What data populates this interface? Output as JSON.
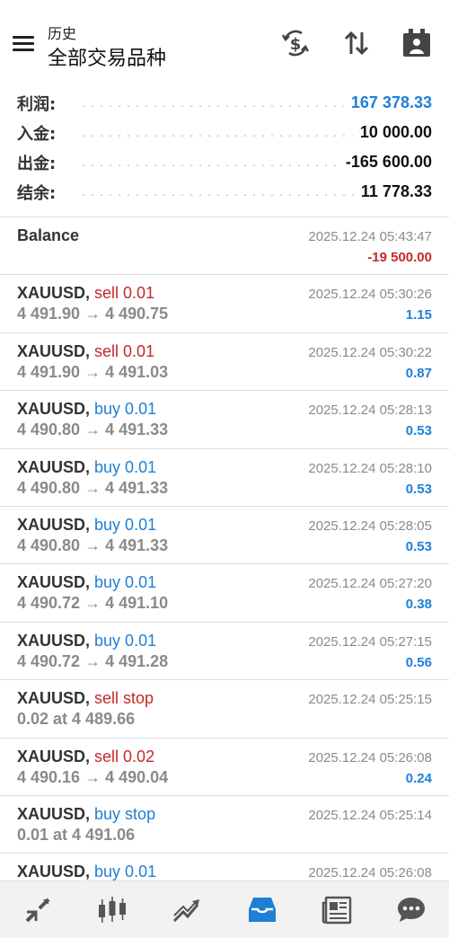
{
  "header": {
    "subtitle": "历史",
    "title": "全部交易品种",
    "icons": [
      "menu-icon",
      "currency-exchange-icon",
      "sort-icon",
      "calendar-period-icon"
    ]
  },
  "summary": [
    {
      "label": "利润:",
      "value": "167 378.33",
      "color": "#1e7fd6"
    },
    {
      "label": "入金:",
      "value": "10 000.00"
    },
    {
      "label": "出金:",
      "value": "-165 600.00"
    },
    {
      "label": "结余:",
      "value": "11 778.33"
    }
  ],
  "deals": [
    {
      "symbol": "Balance",
      "sep": "",
      "action": "",
      "side": "",
      "detail": "",
      "time": "2025.12.24 05:43:47",
      "profit": "-19 500.00",
      "sign": "neg"
    },
    {
      "symbol": "XAUUSD",
      "sep": ", ",
      "action": "sell 0.01",
      "side": "sell",
      "detail": "4 491.90 → 4 490.75",
      "time": "2025.12.24 05:30:26",
      "profit": "1.15",
      "sign": "pos"
    },
    {
      "symbol": "XAUUSD",
      "sep": ", ",
      "action": "sell 0.01",
      "side": "sell",
      "detail": "4 491.90 → 4 491.03",
      "time": "2025.12.24 05:30:22",
      "profit": "0.87",
      "sign": "pos"
    },
    {
      "symbol": "XAUUSD",
      "sep": ", ",
      "action": "buy 0.01",
      "side": "buy",
      "detail": "4 490.80 → 4 491.33",
      "time": "2025.12.24 05:28:13",
      "profit": "0.53",
      "sign": "pos"
    },
    {
      "symbol": "XAUUSD",
      "sep": ", ",
      "action": "buy 0.01",
      "side": "buy",
      "detail": "4 490.80 → 4 491.33",
      "time": "2025.12.24 05:28:10",
      "profit": "0.53",
      "sign": "pos"
    },
    {
      "symbol": "XAUUSD",
      "sep": ", ",
      "action": "buy 0.01",
      "side": "buy",
      "detail": "4 490.80 → 4 491.33",
      "time": "2025.12.24 05:28:05",
      "profit": "0.53",
      "sign": "pos"
    },
    {
      "symbol": "XAUUSD",
      "sep": ", ",
      "action": "buy 0.01",
      "side": "buy",
      "detail": "4 490.72 → 4 491.10",
      "time": "2025.12.24 05:27:20",
      "profit": "0.38",
      "sign": "pos"
    },
    {
      "symbol": "XAUUSD",
      "sep": ", ",
      "action": "buy 0.01",
      "side": "buy",
      "detail": "4 490.72 → 4 491.28",
      "time": "2025.12.24 05:27:15",
      "profit": "0.56",
      "sign": "pos"
    },
    {
      "symbol": "XAUUSD",
      "sep": ", ",
      "action": "sell stop",
      "side": "sell",
      "detail": "0.02 at 4 489.66",
      "time": "2025.12.24 05:25:15",
      "profit": "",
      "sign": "pos"
    },
    {
      "symbol": "XAUUSD",
      "sep": ", ",
      "action": "sell 0.02",
      "side": "sell",
      "detail": "4 490.16 → 4 490.04",
      "time": "2025.12.24 05:26:08",
      "profit": "0.24",
      "sign": "pos"
    },
    {
      "symbol": "XAUUSD",
      "sep": ", ",
      "action": "buy stop",
      "side": "buy",
      "detail": "0.01 at 4 491.06",
      "time": "2025.12.24 05:25:14",
      "profit": "",
      "sign": "pos"
    },
    {
      "symbol": "XAUUSD",
      "sep": ", ",
      "action": "buy 0.01",
      "side": "buy",
      "detail": "",
      "time": "2025.12.24 05:26:08",
      "profit": "",
      "sign": "pos"
    }
  ],
  "nav": {
    "items": [
      "quotes-icon",
      "chart-icon",
      "trade-icon",
      "history-icon",
      "news-icon",
      "chat-icon"
    ],
    "active": "history-icon",
    "active_color": "#1e7fd6"
  }
}
